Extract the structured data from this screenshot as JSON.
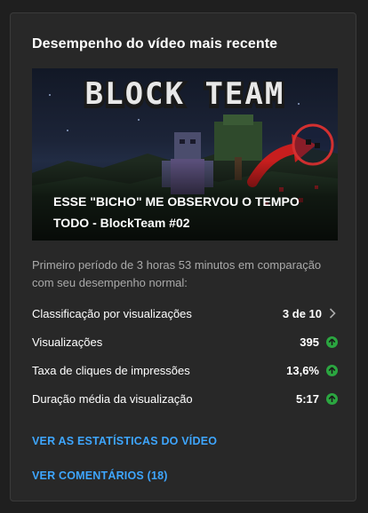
{
  "card": {
    "title": "Desempenho do vídeo mais recente"
  },
  "video": {
    "thumbnail_logo_text": "BLOCK TEAM",
    "title": "ESSE \"BICHO\" ME OBSERVOU O TEMPO TODO - BlockTeam #02"
  },
  "period_text": "Primeiro período de 3 horas 53 minutos em comparação com seu desempenho normal:",
  "metrics": [
    {
      "label": "Classificação por visualizações",
      "value": "3 de 10",
      "icon": "chevron-right-icon"
    },
    {
      "label": "Visualizações",
      "value": "395",
      "icon": "arrow-up-icon"
    },
    {
      "label": "Taxa de cliques de impressões",
      "value": "13,6%",
      "icon": "arrow-up-icon"
    },
    {
      "label": "Duração média da visualização",
      "value": "5:17",
      "icon": "arrow-up-icon"
    }
  ],
  "links": {
    "stats": "VER AS ESTATÍSTICAS DO VÍDEO",
    "comments": "VER COMENTÁRIOS (18)"
  },
  "colors": {
    "card_bg": "#282828",
    "page_bg": "#1f1f1f",
    "link": "#3ea6ff",
    "up_badge": "#2ba640"
  }
}
